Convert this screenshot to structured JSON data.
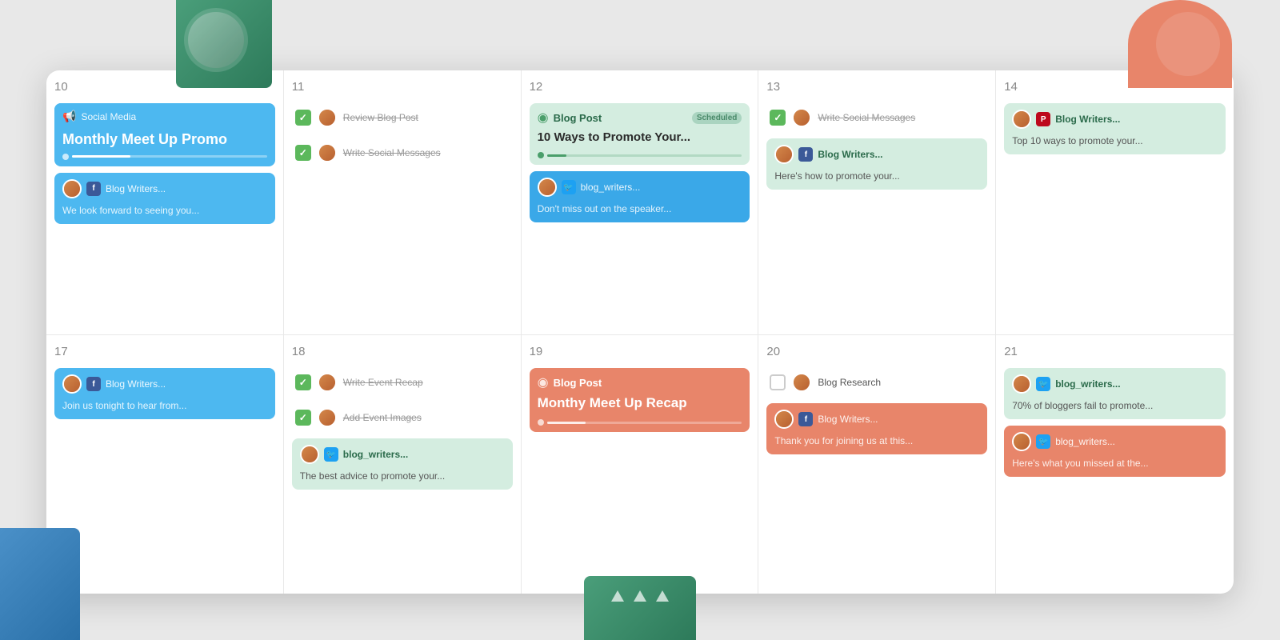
{
  "decorative": {
    "corner_tl": "top-left green decoration",
    "corner_tr": "top-right salmon decoration",
    "corner_bl": "bottom-left blue decoration",
    "corner_bm": "bottom-middle green decoration"
  },
  "calendar": {
    "weeks": [
      {
        "days": [
          {
            "number": "10",
            "cards": [
              {
                "type": "promo",
                "icon": "📢",
                "label": "Social Media",
                "title": "Monthly Meet Up Promo",
                "progress": 30
              },
              {
                "type": "social",
                "platform": "fb",
                "avatar": true,
                "username": "Blog Writers...",
                "text": "We look forward to seeing you..."
              }
            ]
          },
          {
            "number": "11",
            "cards": [
              {
                "type": "task",
                "done": true,
                "avatar": true,
                "label": "Review Blog Post"
              },
              {
                "type": "task",
                "done": true,
                "avatar": true,
                "label": "Write Social Messages"
              }
            ]
          },
          {
            "number": "12",
            "cards": [
              {
                "type": "blog",
                "color": "green",
                "label": "Blog Post",
                "badge": "Scheduled",
                "title": "10 Ways to Promote Your...",
                "progress": 10
              },
              {
                "type": "social",
                "platform": "tw",
                "avatar": true,
                "username": "blog_writers...",
                "text": "Don't miss out on the speaker...",
                "color": "blue"
              }
            ]
          },
          {
            "number": "13",
            "cards": [
              {
                "type": "task",
                "done": true,
                "avatar": true,
                "label": "Write Social Messages"
              },
              {
                "type": "social-fb",
                "platform": "fb",
                "avatar": true,
                "username": "Blog Writers...",
                "text": "Here's how to promote your...",
                "color": "green"
              }
            ]
          },
          {
            "number": "14",
            "cards": [
              {
                "type": "social-pt",
                "platform": "pt",
                "avatar": true,
                "username": "Blog Writers...",
                "color": "green"
              },
              {
                "type": "text-card",
                "text": "Top 10 ways to promote your...",
                "color": "green"
              }
            ]
          }
        ]
      },
      {
        "days": [
          {
            "number": "17",
            "cards": [
              {
                "type": "social",
                "platform": "fb",
                "avatar": true,
                "username": "Blog Writers...",
                "text": "Join us tonight to hear from...",
                "color": "blue"
              }
            ]
          },
          {
            "number": "18",
            "cards": [
              {
                "type": "task",
                "done": true,
                "avatar": true,
                "label": "Write Event Recap"
              },
              {
                "type": "task",
                "done": true,
                "avatar": true,
                "label": "Add Event Images"
              },
              {
                "type": "social",
                "platform": "tw",
                "avatar": true,
                "username": "blog_writers...",
                "text": "The best advice to promote your...",
                "color": "green"
              }
            ]
          },
          {
            "number": "19",
            "cards": [
              {
                "type": "blog",
                "color": "red",
                "label": "Blog Post",
                "title": "Monthy Meet Up Recap",
                "progress": 20
              }
            ]
          },
          {
            "number": "20",
            "cards": [
              {
                "type": "task",
                "done": false,
                "avatar": true,
                "label": "Blog Research"
              },
              {
                "type": "social-fb",
                "platform": "fb",
                "avatar": true,
                "username": "Blog Writers...",
                "text": "Thank you for joining us at this...",
                "color": "red"
              }
            ]
          },
          {
            "number": "21",
            "cards": [
              {
                "type": "social",
                "platform": "tw",
                "avatar": true,
                "username": "blog_writers...",
                "text": "70% of bloggers fail to promote...",
                "color": "green"
              },
              {
                "type": "social",
                "platform": "tw",
                "avatar": true,
                "username": "blog_writers...",
                "text": "Here's what you missed at the...",
                "color": "red"
              }
            ]
          }
        ]
      }
    ]
  }
}
